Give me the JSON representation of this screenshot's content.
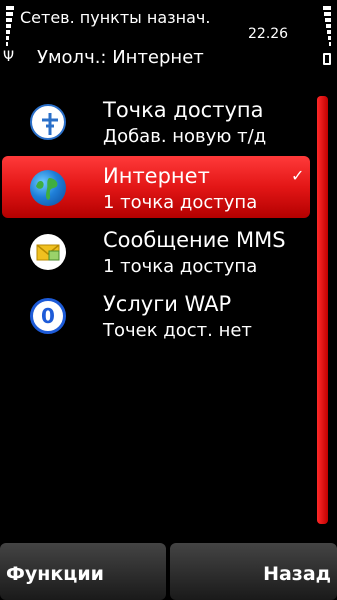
{
  "status": {
    "title": "Сетев. пункты назнач.",
    "time": "22.26",
    "subtitle": "Умолч.: Интернет"
  },
  "list": {
    "items": [
      {
        "name": "Точка доступа",
        "sub": "Добав. новую т/д",
        "icon": "access-point-icon",
        "selected": false
      },
      {
        "name": "Интернет",
        "sub": "1 точка доступа",
        "icon": "globe-icon",
        "selected": true,
        "check": "✓"
      },
      {
        "name": "Сообщение MMS",
        "sub": "1 точка доступа",
        "icon": "mms-envelope-icon",
        "selected": false
      },
      {
        "name": "Услуги WAP",
        "sub": "Точек дост. нет",
        "icon": "wap-icon",
        "selected": false
      }
    ]
  },
  "softkeys": {
    "left": "Функции",
    "right": "Назад"
  },
  "colors": {
    "accent": "#e31616",
    "background": "#000000"
  }
}
